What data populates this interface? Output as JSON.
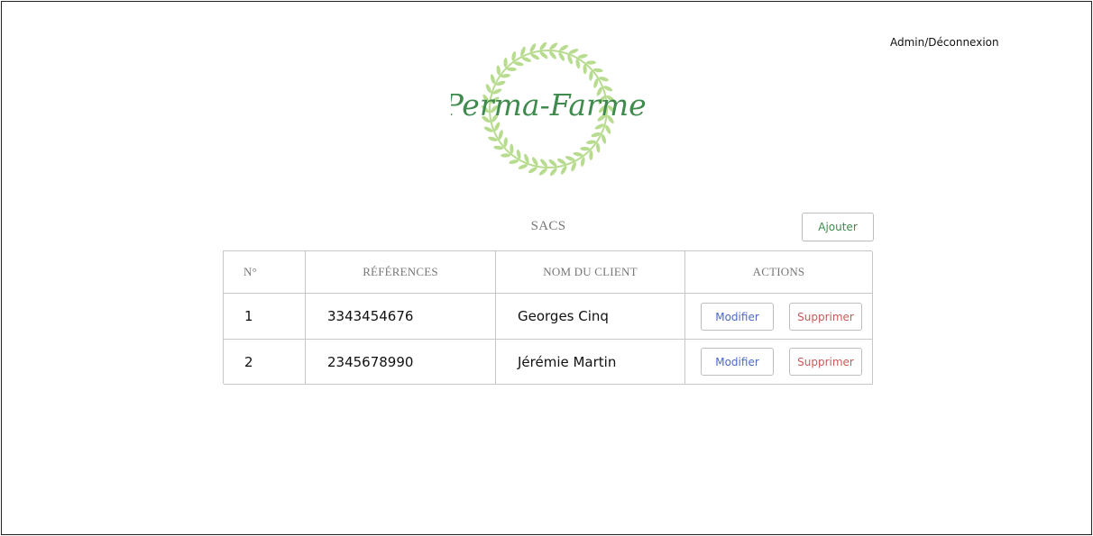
{
  "header": {
    "admin_link": "Admin/Déconnexion"
  },
  "brand": {
    "name": "Perma-Farmer",
    "text_color": "#3f8a4d",
    "wreath_color": "#b8dc8f"
  },
  "page": {
    "title": "SACS",
    "add_button": "Ajouter"
  },
  "table": {
    "columns": [
      "N°",
      "RÉFÉRENCES",
      "NOM DU CLIENT",
      "ACTIONS"
    ],
    "rows": [
      {
        "number": "1",
        "reference": "3343454676",
        "client": "Georges Cinq",
        "edit_label": "Modifier",
        "delete_label": "Supprimer"
      },
      {
        "number": "2",
        "reference": "2345678990",
        "client": "Jérémie Martin",
        "edit_label": "Modifier",
        "delete_label": "Supprimer"
      }
    ]
  },
  "colors": {
    "edit": "#4e68c5",
    "delete": "#c65b5b",
    "border": "#c7c7c7"
  }
}
